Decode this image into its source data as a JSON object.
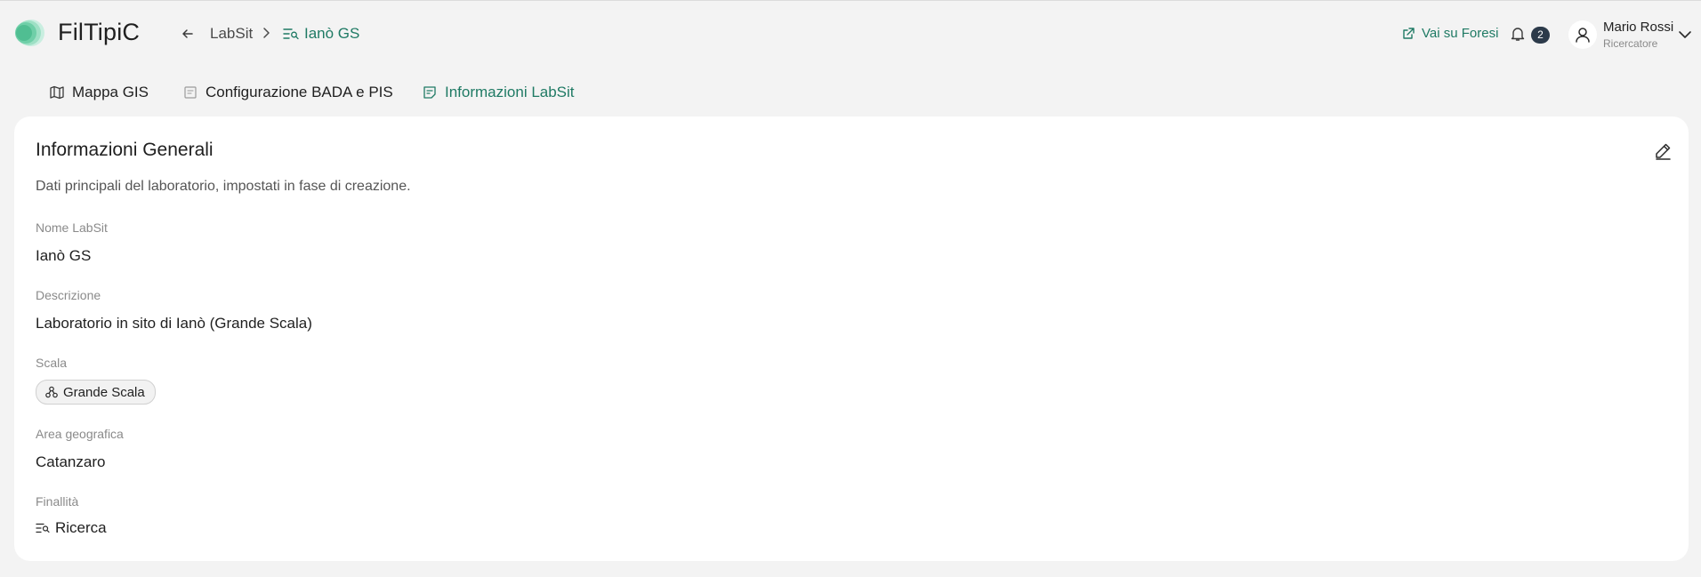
{
  "app": {
    "name": "FilTipiC"
  },
  "breadcrumb": {
    "parent": "LabSit",
    "current": "Ianò GS"
  },
  "header": {
    "external_link": "Vai su Foresi",
    "notifications_count": "2",
    "user": {
      "name": "Mario Rossi",
      "role": "Ricercatore"
    }
  },
  "tabs": [
    {
      "label": "Mappa GIS",
      "icon": "map-icon"
    },
    {
      "label": "Configurazione BADA e PIS",
      "icon": "document-icon"
    },
    {
      "label": "Informazioni LabSit",
      "icon": "info-note-icon"
    }
  ],
  "active_tab": "Informazioni LabSit",
  "card": {
    "title": "Informazioni Generali",
    "description": "Dati principali del laboratorio, impostati in fase di creazione.",
    "fields": {
      "name": {
        "label": "Nome LabSit",
        "value": "Ianò GS"
      },
      "description": {
        "label": "Descrizione",
        "value": "Laboratorio in sito di Ianò (Grande Scala)"
      },
      "scale": {
        "label": "Scala",
        "value": "Grande Scala"
      },
      "area": {
        "label": "Area geografica",
        "value": "Catanzaro"
      },
      "purpose": {
        "label": "Finallità",
        "value": "Ricerca"
      }
    }
  },
  "colors": {
    "accent": "#1f7a64",
    "background": "#f3f3f3",
    "badge": "#2c3a4a"
  }
}
